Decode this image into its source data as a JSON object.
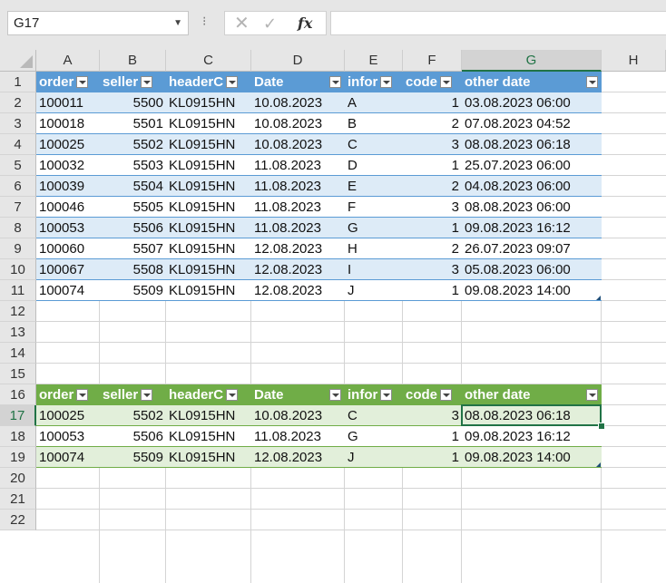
{
  "formula_bar": {
    "name_box": "G17",
    "separator": "⁝",
    "cancel_icon": "✕",
    "enter_icon": "✓",
    "fx_label": "fx",
    "formula_value": ""
  },
  "columns": [
    "A",
    "B",
    "C",
    "D",
    "E",
    "F",
    "G",
    "H"
  ],
  "selected_column": "G",
  "selected_row": 17,
  "rows": [
    "1",
    "2",
    "3",
    "4",
    "5",
    "6",
    "7",
    "8",
    "9",
    "10",
    "11",
    "12",
    "13",
    "14",
    "15",
    "16",
    "17",
    "18",
    "19",
    "20",
    "21",
    "22"
  ],
  "colors": {
    "table1_header": "#5b9bd5",
    "table1_band": "#ddebf7",
    "table2_header": "#70ad47",
    "table2_band": "#e2efda",
    "selection": "#217346"
  },
  "table1": {
    "headers": [
      "order",
      "seller",
      "headerC",
      "Date",
      "infor",
      "code",
      "other date"
    ],
    "rows": [
      [
        "100011",
        "5500",
        "KL0915HN",
        "10.08.2023",
        "A",
        "1",
        "03.08.2023 06:00"
      ],
      [
        "100018",
        "5501",
        "KL0915HN",
        "10.08.2023",
        "B",
        "2",
        "07.08.2023 04:52"
      ],
      [
        "100025",
        "5502",
        "KL0915HN",
        "10.08.2023",
        "C",
        "3",
        "08.08.2023 06:18"
      ],
      [
        "100032",
        "5503",
        "KL0915HN",
        "11.08.2023",
        "D",
        "1",
        "25.07.2023 06:00"
      ],
      [
        "100039",
        "5504",
        "KL0915HN",
        "11.08.2023",
        "E",
        "2",
        "04.08.2023 06:00"
      ],
      [
        "100046",
        "5505",
        "KL0915HN",
        "11.08.2023",
        "F",
        "3",
        "08.08.2023 06:00"
      ],
      [
        "100053",
        "5506",
        "KL0915HN",
        "11.08.2023",
        "G",
        "1",
        "09.08.2023 16:12"
      ],
      [
        "100060",
        "5507",
        "KL0915HN",
        "12.08.2023",
        "H",
        "2",
        "26.07.2023 09:07"
      ],
      [
        "100067",
        "5508",
        "KL0915HN",
        "12.08.2023",
        "I",
        "3",
        "05.08.2023 06:00"
      ],
      [
        "100074",
        "5509",
        "KL0915HN",
        "12.08.2023",
        "J",
        "1",
        "09.08.2023 14:00"
      ]
    ]
  },
  "table2": {
    "headers": [
      "order",
      "seller",
      "headerC",
      "Date",
      "infor",
      "code",
      "other date"
    ],
    "rows": [
      [
        "100025",
        "5502",
        "KL0915HN",
        "10.08.2023",
        "C",
        "3",
        "08.08.2023 06:18"
      ],
      [
        "100053",
        "5506",
        "KL0915HN",
        "11.08.2023",
        "G",
        "1",
        "09.08.2023 16:12"
      ],
      [
        "100074",
        "5509",
        "KL0915HN",
        "12.08.2023",
        "J",
        "1",
        "09.08.2023 14:00"
      ]
    ]
  }
}
